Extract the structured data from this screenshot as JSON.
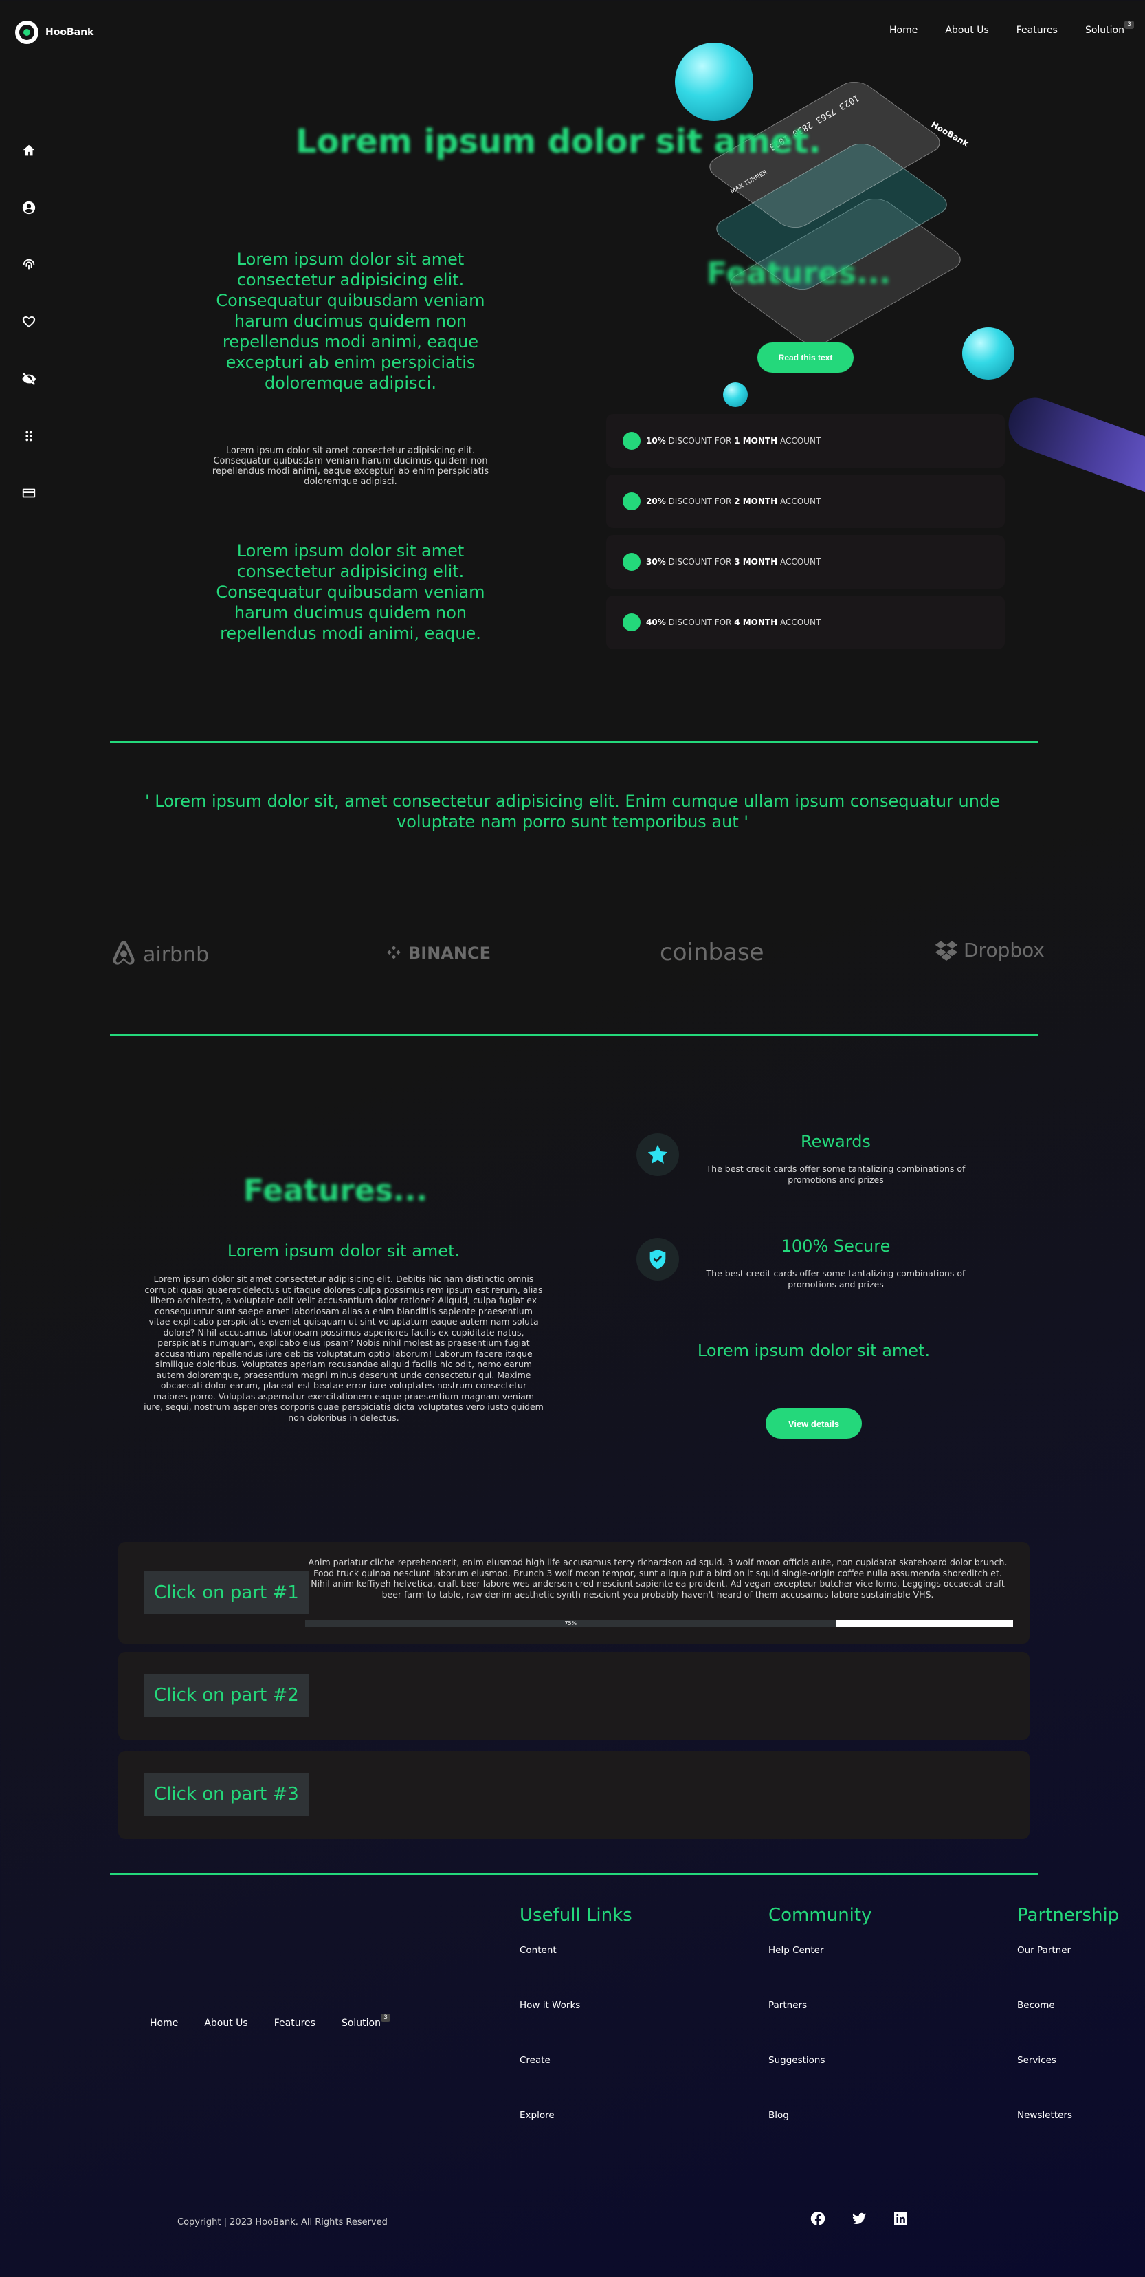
{
  "brand": {
    "name": "HooBank"
  },
  "nav": [
    {
      "label": "Home"
    },
    {
      "label": "About Us"
    },
    {
      "label": "Features"
    },
    {
      "label": "Solution",
      "badge": "3"
    }
  ],
  "sidebar": [
    "home-icon",
    "user-icon",
    "fingerprint-icon",
    "heart-icon",
    "eye-off-icon",
    "grid-icon",
    "credit-card-icon"
  ],
  "hero": {
    "title": "Lorem ipsum dolor sit amet.",
    "features_blur": "Features...",
    "paragraph1": "Lorem ipsum dolor sit amet consectetur adipisicing elit. Consequatur quibusdam veniam harum ducimus quidem non repellendus modi animi, eaque excepturi ab enim perspiciatis doloremque adipisci.",
    "small": "Lorem ipsum dolor sit amet consectetur adipisicing elit. Consequatur quibusdam veniam harum ducimus quidem non repellendus modi animi, eaque excepturi ab enim perspiciatis doloremque adipisci.",
    "paragraph2": "Lorem ipsum dolor sit amet consectetur adipisicing elit. Consequatur quibusdam veniam harum ducimus quidem non repellendus modi animi, eaque.",
    "read_button": "Read this text"
  },
  "card": {
    "number": "1023 7563 2830 1023",
    "holder": "MAX TURNER"
  },
  "discounts": [
    {
      "pct": "10%",
      "mid": "DISCOUNT FOR",
      "period": "1 MONTH",
      "end": "ACCOUNT"
    },
    {
      "pct": "20%",
      "mid": "DISCOUNT FOR",
      "period": "2 MONTH",
      "end": "ACCOUNT"
    },
    {
      "pct": "30%",
      "mid": "DISCOUNT FOR",
      "period": "3 MONTH",
      "end": "ACCOUNT"
    },
    {
      "pct": "40%",
      "mid": "DISCOUNT FOR",
      "period": "4 MONTH",
      "end": "ACCOUNT"
    }
  ],
  "quote": "' Lorem ipsum dolor sit, amet consectetur adipisicing elit. Enim cumque ullam ipsum consequatur unde voluptate nam porro sunt temporibus aut '",
  "brands": [
    "airbnb",
    "BINANCE",
    "coinbase",
    "Dropbox"
  ],
  "features": {
    "blur_title": "Features...",
    "subtitle": "Lorem ipsum dolor sit amet.",
    "text": "Lorem ipsum dolor sit amet consectetur adipisicing elit. Debitis hic nam distinctio omnis corrupti quasi quaerat delectus ut itaque dolores culpa possimus rem ipsum est rerum, alias libero architecto, a voluptate odit velit accusantium dolor ratione? Aliquid, culpa fugiat ex consequuntur sunt saepe amet laboriosam alias a enim blanditiis sapiente praesentium vitae explicabo perspiciatis eveniet quisquam ut sint voluptatum eaque autem nam soluta dolore? Nihil accusamus laboriosam possimus asperiores facilis ex cupiditate natus, perspiciatis numquam, explicabo eius ipsam? Nobis nihil molestias praesentium fugiat accusantium repellendus iure debitis voluptatum optio laborum! Laborum facere itaque similique doloribus. Voluptates aperiam recusandae aliquid facilis hic odit, nemo earum autem doloremque, praesentium magni minus deserunt unde consectetur qui. Maxime obcaecati dolor earum, placeat est beatae error iure voluptates nostrum consectetur maiores porro. Voluptas aspernatur exercitationem eaque praesentium magnam veniam iure, sequi, nostrum asperiores corporis quae perspiciatis dicta voluptates vero iusto quidem non doloribus in delectus.",
    "items": [
      {
        "title": "Rewards",
        "desc": "The best credit cards offer some tantalizing combinations of promotions and prizes",
        "icon": "star-icon"
      },
      {
        "title": "100% Secure",
        "desc": "The best credit cards offer some tantalizing combinations of promotions and prizes",
        "icon": "shield-icon"
      }
    ],
    "right_subtitle": "Lorem ipsum dolor sit amet.",
    "view_button": "View details"
  },
  "parts": {
    "items": [
      {
        "label": "Click on part #1"
      },
      {
        "label": "Click on part #2"
      },
      {
        "label": "Click on part #3"
      }
    ],
    "text": "Anim pariatur cliche reprehenderit, enim eiusmod high life accusamus terry richardson ad squid. 3 wolf moon officia aute, non cupidatat skateboard dolor brunch. Food truck quinoa nesciunt laborum eiusmod. Brunch 3 wolf moon tempor, sunt aliqua put a bird on it squid single-origin coffee nulla assumenda shoreditch et. Nihil anim keffiyeh helvetica, craft beer labore wes anderson cred nesciunt sapiente ea proident. Ad vegan excepteur butcher vice lomo. Leggings occaecat craft beer farm-to-table, raw denim aesthetic synth nesciunt you probably haven't heard of them accusamus labore sustainable VHS.",
    "progress": 0.75,
    "progress_label": "75%"
  },
  "footer": {
    "nav": [
      {
        "label": "Home"
      },
      {
        "label": "About Us"
      },
      {
        "label": "Features"
      },
      {
        "label": "Solution",
        "badge": "3"
      }
    ],
    "columns": [
      {
        "title": "Usefull Links",
        "links": [
          "Content",
          "How it Works",
          "Create",
          "Explore"
        ]
      },
      {
        "title": "Community",
        "links": [
          "Help Center",
          "Partners",
          "Suggestions",
          "Blog"
        ]
      },
      {
        "title": "Partnership",
        "links": [
          "Our Partner",
          "Become",
          "Services",
          "Newsletters"
        ]
      }
    ],
    "copyright": "Copyright | 2023 HooBank. All Rights Reserved",
    "social": [
      "facebook-icon",
      "twitter-icon",
      "linkedin-icon"
    ]
  },
  "colors": {
    "accent": "#24d87b",
    "background": "#141414",
    "panel": "#1c1a1b",
    "cyan": "#2ee2f2"
  }
}
